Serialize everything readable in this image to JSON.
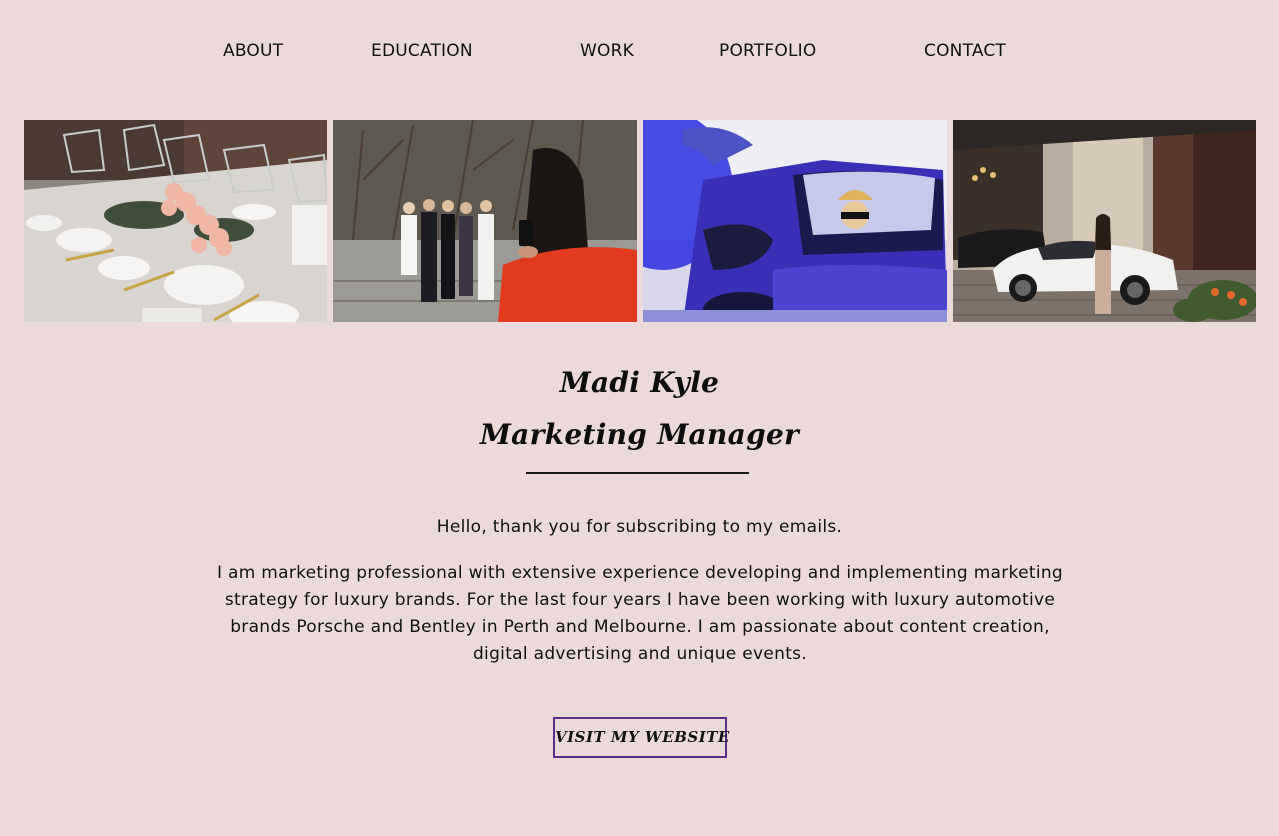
{
  "nav": {
    "items": [
      {
        "label": "ABOUT"
      },
      {
        "label": "EDUCATION"
      },
      {
        "label": "WORK"
      },
      {
        "label": "PORTFOLIO"
      },
      {
        "label": "CONTACT"
      }
    ]
  },
  "gallery": {
    "photos": [
      {
        "subject": "wedding-table-setting"
      },
      {
        "subject": "group-photo-event"
      },
      {
        "subject": "blue-bentley-convertible"
      },
      {
        "subject": "white-porsche-model"
      }
    ]
  },
  "hero": {
    "name": "Madi Kyle",
    "role": "Marketing Manager"
  },
  "content": {
    "greeting": "Hello, thank you for subscribing to my emails.",
    "bio": "I am marketing professional with extensive experience developing and implementing marketing strategy for luxury brands. For the last four years I have been working with luxury automotive brands Porsche and Bentley in Perth and Melbourne. I am passionate about content creation, digital advertising and unique events."
  },
  "cta": {
    "label": "Visit my website"
  },
  "colors": {
    "background": "#ecdada",
    "text": "#111111",
    "button_border": "#5b2d8e"
  }
}
